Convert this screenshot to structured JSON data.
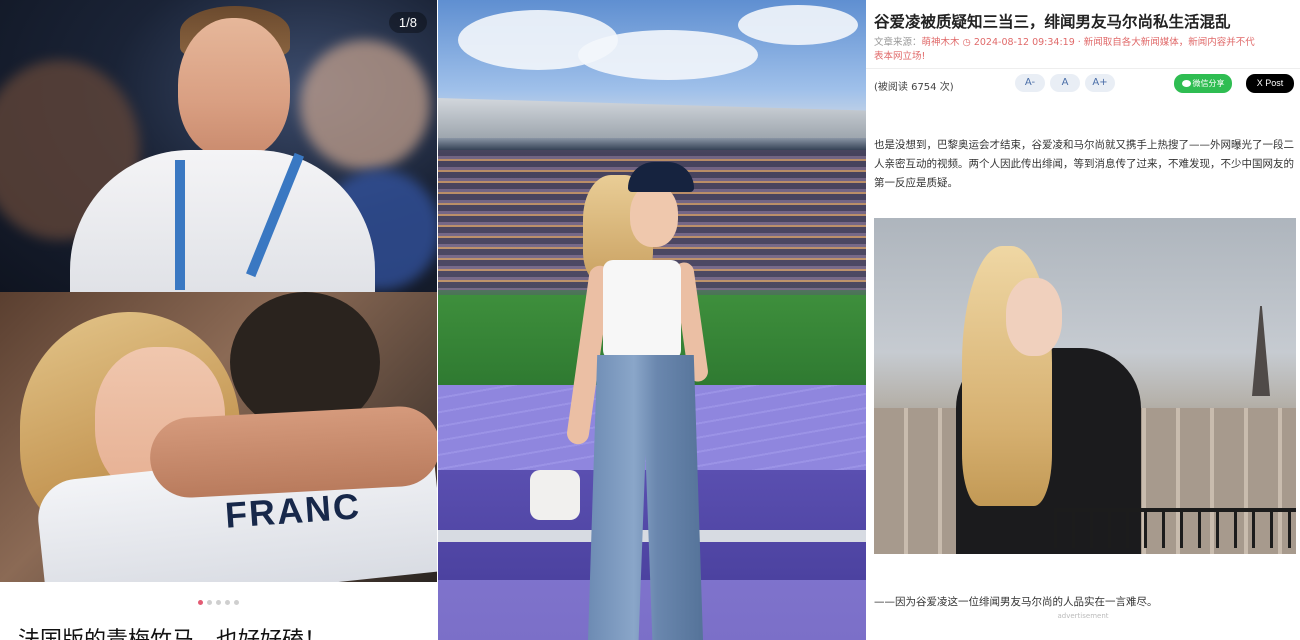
{
  "left": {
    "counter": "1/8",
    "shirt_text": "FRANC",
    "caption": "法国版的青梅竹马，也好好磕！",
    "dots": [
      {
        "active": true
      },
      {
        "active": false
      },
      {
        "active": false
      },
      {
        "active": false
      },
      {
        "active": false
      }
    ]
  },
  "right": {
    "title": "谷爱凌被质疑知三当三，绯闻男友马尔尚私生活混乱",
    "meta_line1_label": "文章来源：",
    "meta_line1": "萌神木木 ◷ 2024-08-12 09:34:19 · 新闻取自各大新闻媒体，新闻内容并不代",
    "meta_line2": "表本网立场!",
    "reads": "(被阅读 6754 次)",
    "font_buttons": [
      "A-",
      "A",
      "A+"
    ],
    "share_wechat": "微信分享",
    "share_x": "X Post",
    "paragraph": "也是没想到，巴黎奥运会才结束，谷爱凌和马尔尚就又携手上热搜了——外网曝光了一段二人亲密互动的视频。两个人因此传出绯闻，等到消息传了过来，不难发现，不少中国网友的第一反应是质疑。",
    "footer": "——因为谷爱凌这一位绯闻男友马尔尚的人品实在一言难尽。",
    "ad_label": "advertisement"
  }
}
